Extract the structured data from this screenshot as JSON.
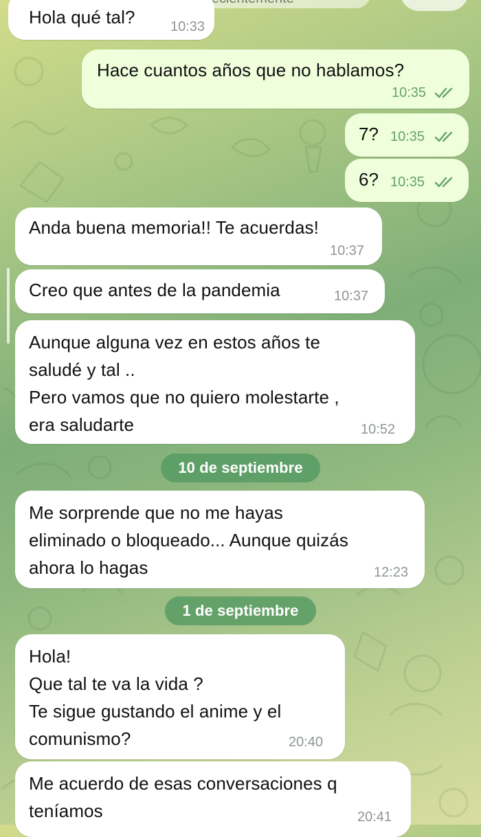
{
  "header": {
    "status_text": "últ. vez recientemente"
  },
  "messages": [
    {
      "id": "m1",
      "direction": "incoming",
      "text": "Hola qué tal?",
      "time": "10:33"
    },
    {
      "id": "m2",
      "direction": "outgoing",
      "text": "Hace cuantos años que no hablamos?",
      "time": "10:35",
      "status": "read"
    },
    {
      "id": "m3",
      "direction": "outgoing",
      "text": "7?",
      "time": "10:35",
      "status": "read"
    },
    {
      "id": "m4",
      "direction": "outgoing",
      "text": "6?",
      "time": "10:35",
      "status": "read"
    },
    {
      "id": "m5",
      "direction": "incoming",
      "text": "Anda buena memoria!! Te acuerdas!",
      "time": "10:37"
    },
    {
      "id": "m6",
      "direction": "incoming",
      "text": "Creo que antes de la pandemia",
      "time": "10:37"
    },
    {
      "id": "m7",
      "direction": "incoming",
      "text": "Aunque alguna vez en estos años te\nsaludé y tal ..\nPero vamos que no quiero molestarte ,\nera saludarte",
      "time": "10:52"
    },
    {
      "id": "m8",
      "direction": "incoming",
      "text": "Me sorprende que no me hayas\neliminado o bloqueado... Aunque quizás\nahora lo hagas",
      "time": "12:23"
    },
    {
      "id": "m9",
      "direction": "incoming",
      "text": "Hola!\nQue tal te va la vida ?\nTe sigue gustando el anime y el\ncomunismo?",
      "time": "20:40"
    },
    {
      "id": "m10",
      "direction": "incoming",
      "text": "Me acuerdo de esas conversaciones q\nteníamos",
      "time": "20:41"
    }
  ],
  "date_separators": [
    {
      "id": "d1",
      "label": "10 de septiembre"
    },
    {
      "id": "d2",
      "label": "1 de septiembre"
    }
  ],
  "colors": {
    "incoming_bubble": "#ffffff",
    "outgoing_bubble": "#effedb",
    "time_incoming": "#8f9596",
    "time_outgoing": "#66a26b",
    "date_badge": "#5a9a67"
  }
}
